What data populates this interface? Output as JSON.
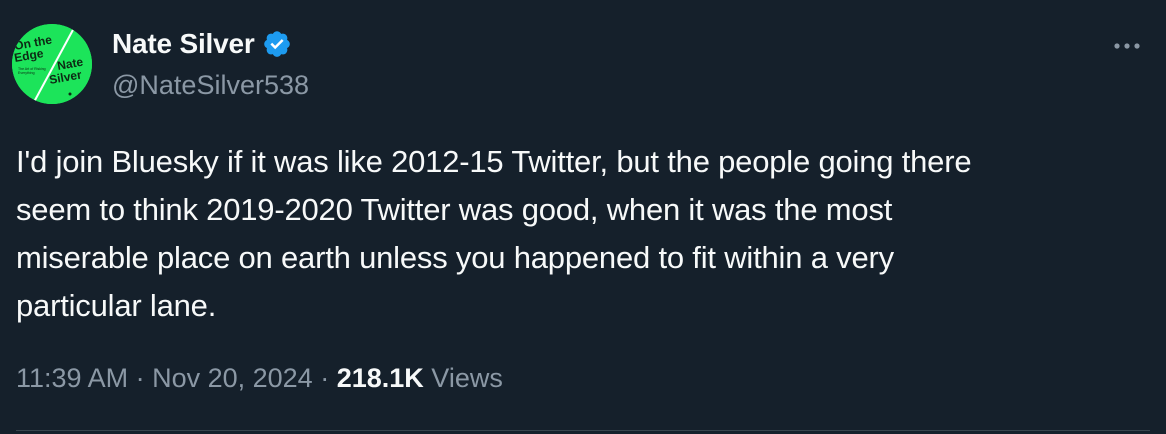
{
  "author": {
    "display_name": "Nate Silver",
    "handle": "@NateSilver538",
    "verified": true,
    "verified_color": "#1d9bf0",
    "avatar": {
      "background_color": "#1ce45a",
      "text_lines": [
        "On the",
        "Edge",
        "Nate",
        "Silver"
      ]
    }
  },
  "menu": {
    "more_icon": "more-horizontal-icon"
  },
  "tweet": {
    "text": "I'd join Bluesky if it was like 2012-15 Twitter, but the people going there\nseem to think 2019-2020 Twitter was good, when it was the most\nmiserable place on earth unless you happened to fit within a very\nparticular lane."
  },
  "meta": {
    "time": "11:39 AM",
    "separator": " · ",
    "date": "Nov 20, 2024",
    "views_count": "218.1K",
    "views_label": "Views"
  },
  "theme": {
    "background": "#15202b",
    "text_primary": "#f7f9f9",
    "text_secondary": "#8b98a5",
    "divider": "#38444d"
  }
}
